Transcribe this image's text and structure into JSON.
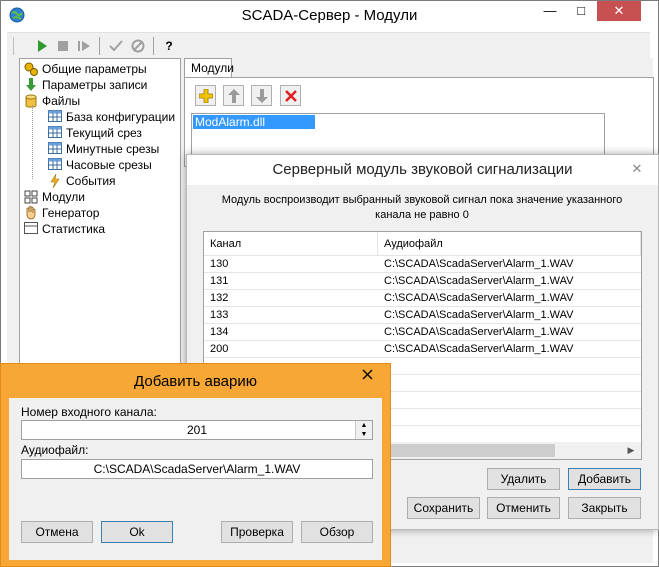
{
  "main": {
    "title": "SCADA-Сервер - Модули",
    "toolbar_help": "?"
  },
  "tree": {
    "items": [
      {
        "label": "Общие параметры"
      },
      {
        "label": "Параметры записи"
      },
      {
        "label": "Файлы"
      },
      {
        "label": "База конфигурации"
      },
      {
        "label": "Текущий срез"
      },
      {
        "label": "Минутные срезы"
      },
      {
        "label": "Часовые срезы"
      },
      {
        "label": "События"
      },
      {
        "label": "Модули"
      },
      {
        "label": "Генератор"
      },
      {
        "label": "Статистика"
      }
    ]
  },
  "tabs": {
    "modules_label": "Модули",
    "module_list": [
      "ModAlarm.dll"
    ]
  },
  "alarm": {
    "title": "Серверный модуль звуковой сигнализации",
    "description": "Модуль воспроизводит выбранный звуковой сигнал пока значение указанного канала не равно 0",
    "columns": [
      "Канал",
      "Аудиофайл"
    ],
    "rows": [
      {
        "channel": "130",
        "file": "C:\\SCADA\\ScadaServer\\Alarm_1.WAV"
      },
      {
        "channel": "131",
        "file": "C:\\SCADA\\ScadaServer\\Alarm_1.WAV"
      },
      {
        "channel": "132",
        "file": "C:\\SCADA\\ScadaServer\\Alarm_1.WAV"
      },
      {
        "channel": "133",
        "file": "C:\\SCADA\\ScadaServer\\Alarm_1.WAV"
      },
      {
        "channel": "134",
        "file": "C:\\SCADA\\ScadaServer\\Alarm_1.WAV"
      },
      {
        "channel": "200",
        "file": "C:\\SCADA\\ScadaServer\\Alarm_1.WAV"
      }
    ],
    "buttons": {
      "delete": "Удалить",
      "add": "Добавить",
      "save": "Сохранить",
      "cancel": "Отменить",
      "close": "Закрыть"
    }
  },
  "add_dialog": {
    "title": "Добавить аварию",
    "channel_label": "Номер входного канала:",
    "channel_value": "201",
    "audio_label": "Аудиофайл:",
    "audio_value": "C:\\SCADA\\ScadaServer\\Alarm_1.WAV",
    "buttons": {
      "cancel": "Отмена",
      "ok": "Ok",
      "check": "Проверка",
      "browse": "Обзор"
    }
  },
  "colors": {
    "accent_orange": "#f7a735",
    "selection_blue": "#3399ff",
    "play_green": "#2e9b2e",
    "delete_red": "#e02020"
  }
}
